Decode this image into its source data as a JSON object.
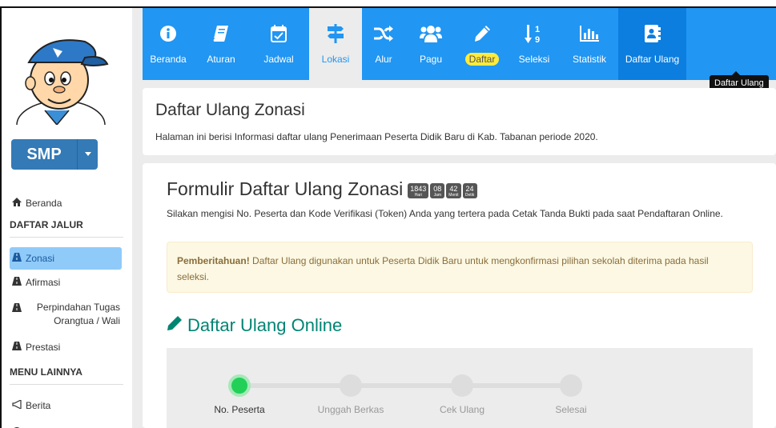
{
  "nav": {
    "items": [
      {
        "label": "Beranda",
        "icon": "info-circle-icon"
      },
      {
        "label": "Aturan",
        "icon": "book-icon"
      },
      {
        "label": "Jadwal",
        "icon": "calendar-check-icon"
      },
      {
        "label": "Lokasi",
        "icon": "signpost-icon"
      },
      {
        "label": "Alur",
        "icon": "random-icon"
      },
      {
        "label": "Pagu",
        "icon": "users-icon"
      },
      {
        "label": "Daftar",
        "icon": "pencil-icon"
      },
      {
        "label": "Seleksi",
        "icon": "sort-numeric-icon"
      },
      {
        "label": "Statistik",
        "icon": "bar-chart-icon"
      },
      {
        "label": "Daftar Ulang",
        "icon": "address-book-icon"
      }
    ],
    "tooltip": "Daftar Ulang",
    "colors": {
      "bar": "#2196f3",
      "highlight": "#ffeb3b"
    }
  },
  "sidebar": {
    "level_button": "SMP",
    "home_link": "Beranda",
    "section_jalur": "DAFTAR JALUR",
    "jalur_items": [
      "Zonasi",
      "Afirmasi",
      "Perpindahan Tugas Orangtua / Wali",
      "Prestasi"
    ],
    "section_menu": "MENU LAINNYA",
    "menu_items": [
      "Berita"
    ]
  },
  "header": {
    "title": "Daftar Ulang Zonasi",
    "description": "Halaman ini berisi Informasi daftar ulang Penerimaan Peserta Didik Baru di Kab. Tabanan periode 2020."
  },
  "form": {
    "title": "Formulir Daftar Ulang Zonasi",
    "countdown": [
      {
        "value": "1843",
        "unit": "Hari"
      },
      {
        "value": "08",
        "unit": "Jam"
      },
      {
        "value": "42",
        "unit": "Menit"
      },
      {
        "value": "24",
        "unit": "Detik"
      }
    ],
    "description": "Silakan mengisi No. Peserta dan Kode Verifikasi (Token) Anda yang tertera pada Cetak Tanda Bukti pada saat Pendaftaran Online.",
    "alert_bold": "Pemberitahuan!",
    "alert_text": " Daftar Ulang digunakan untuk Peserta Didik Baru untuk mengkonfirmasi pilihan sekolah diterima pada hasil seleksi.",
    "online_title": "Daftar Ulang Online",
    "steps": [
      "No. Peserta",
      "Unggah Berkas",
      "Cek Ulang",
      "Selesai"
    ],
    "current_step": 1
  }
}
